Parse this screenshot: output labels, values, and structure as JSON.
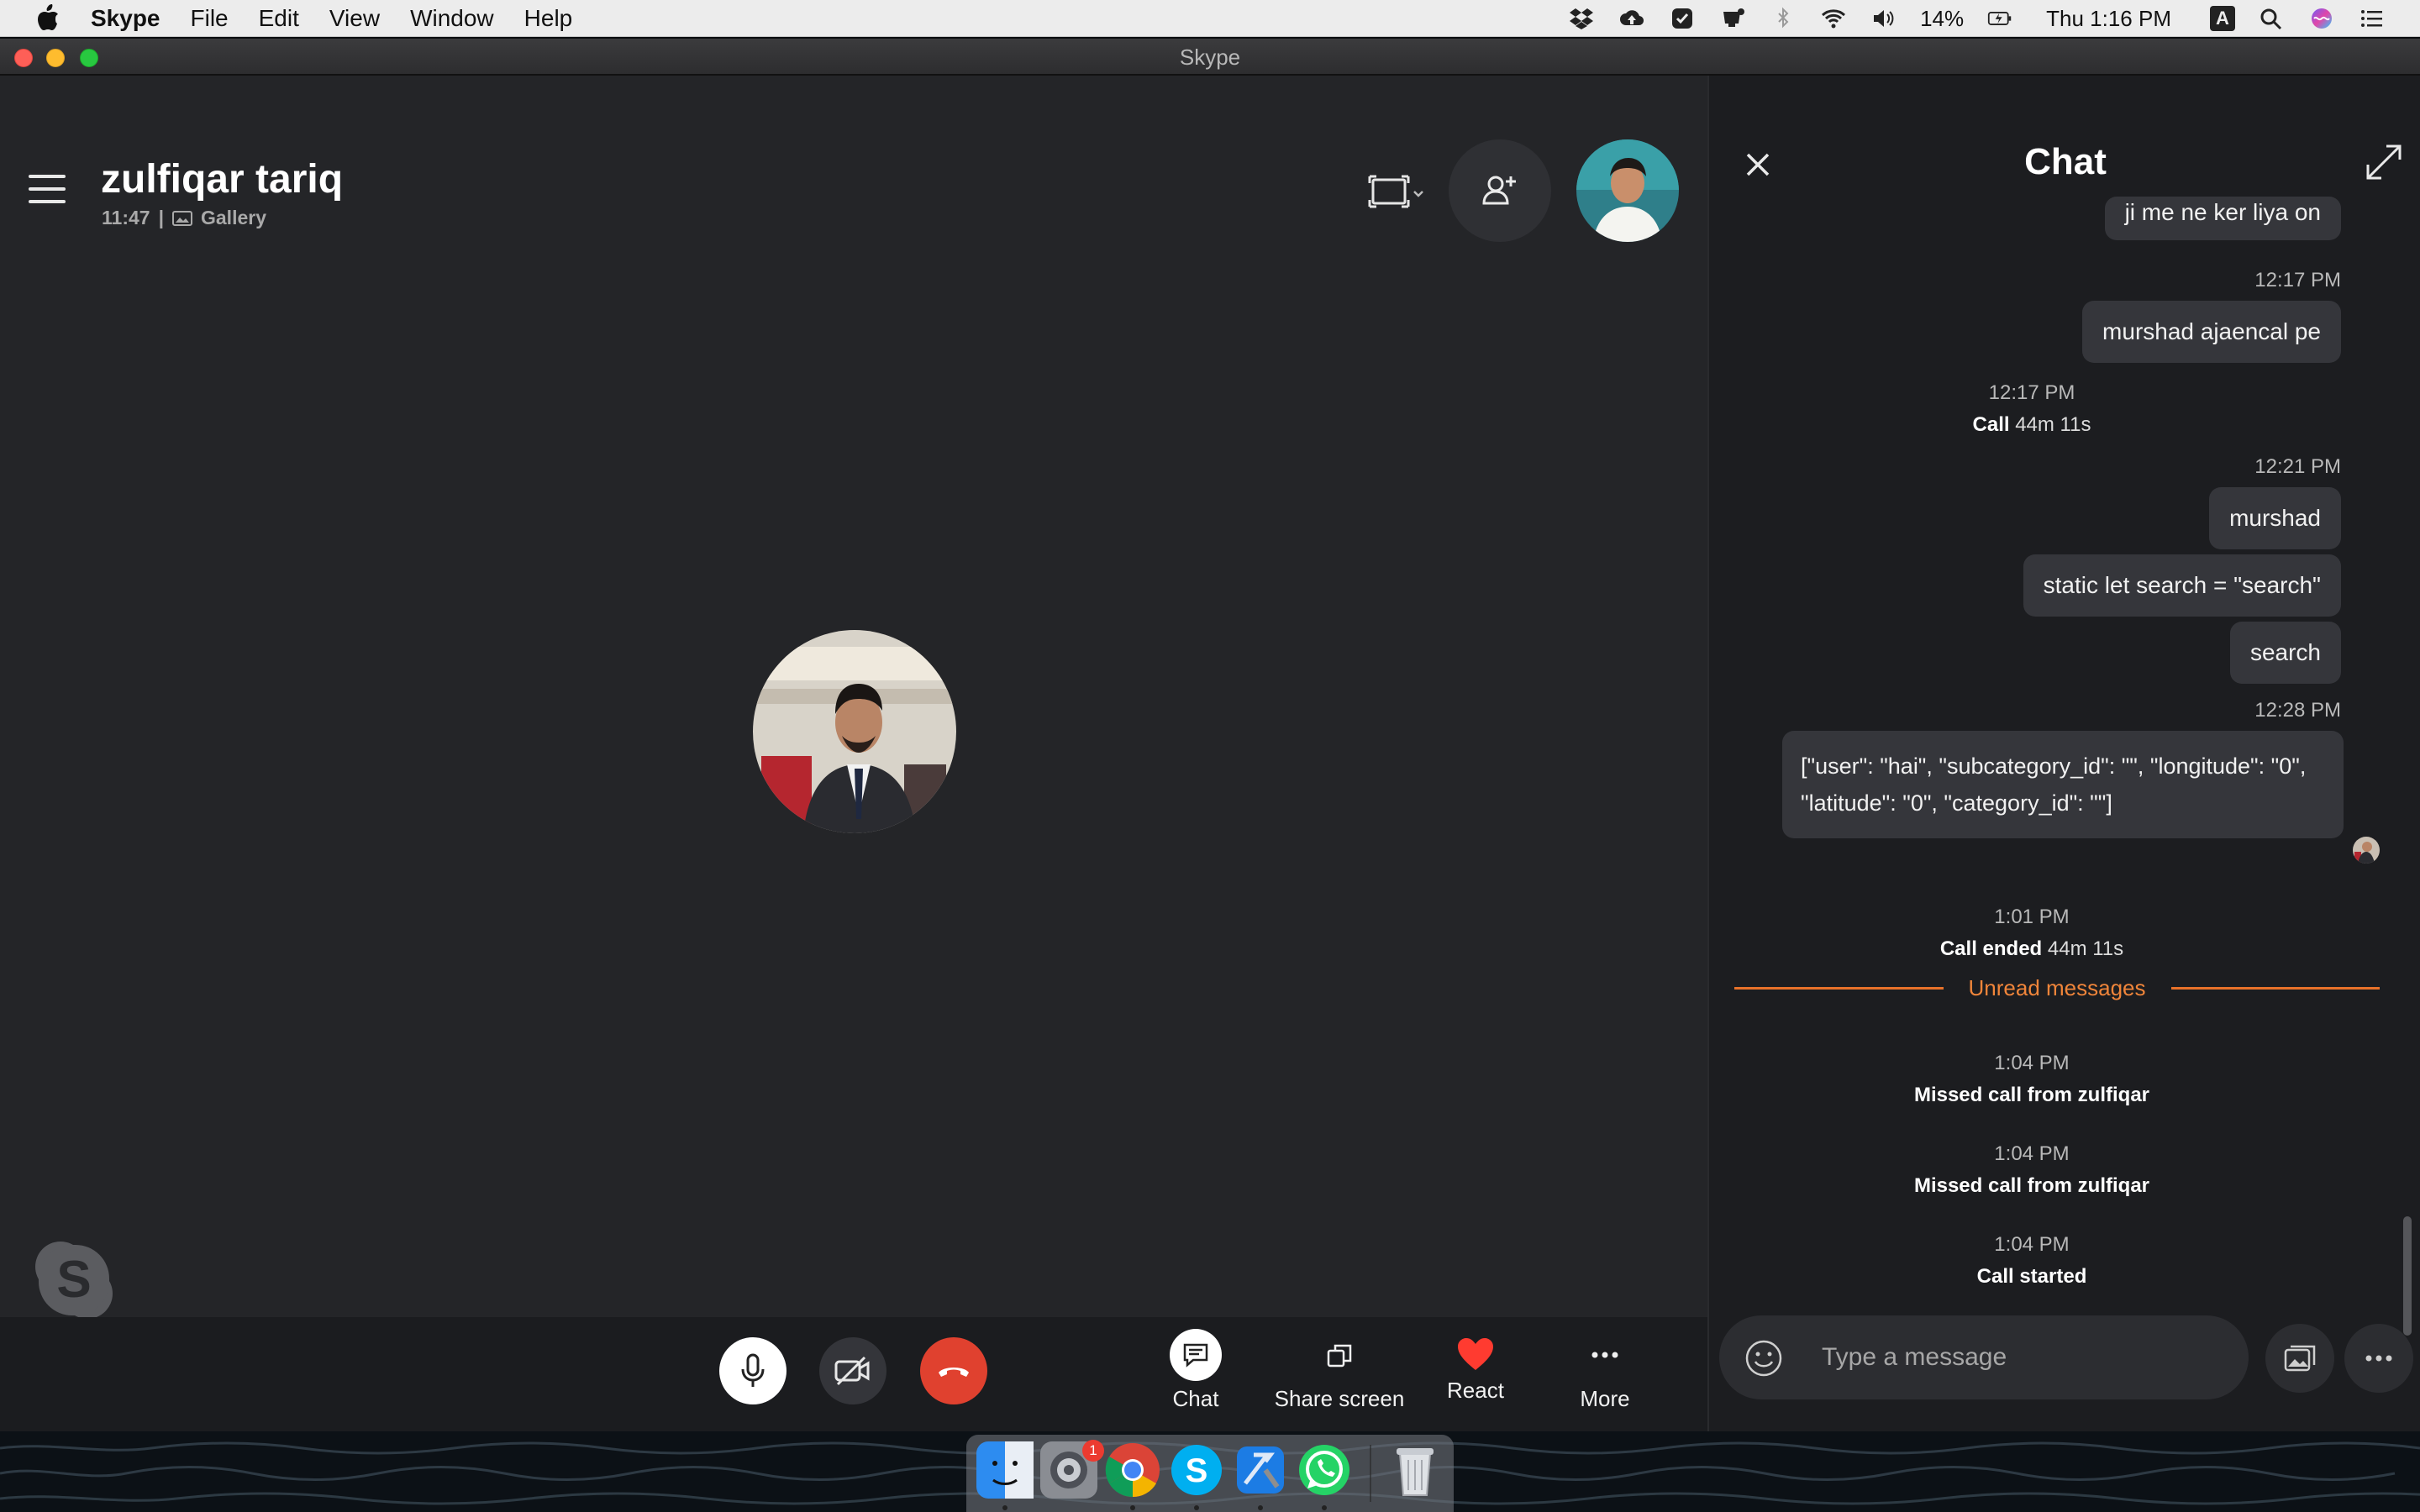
{
  "menubar": {
    "app_name": "Skype",
    "menus": [
      "File",
      "Edit",
      "View",
      "Window",
      "Help"
    ],
    "battery": "14%",
    "clock": "Thu 1:16 PM",
    "input_source": "A"
  },
  "window": {
    "title": "Skype"
  },
  "call": {
    "contact_name": "zulfiqar tariq",
    "duration": "11:47",
    "separator": "|",
    "view_mode": "Gallery"
  },
  "controls": {
    "chat": "Chat",
    "share_screen": "Share screen",
    "react": "React",
    "more": "More"
  },
  "chat": {
    "title": "Chat",
    "messages": {
      "partial": "ji me ne ker liya on",
      "t1": "12:17 PM",
      "m1": "murshad ajaencal pe",
      "t2": "12:17 PM",
      "call_label": "Call",
      "call_duration": "44m 11s",
      "t3": "12:21 PM",
      "m2": "murshad",
      "m3": "static let search = \"search\"",
      "m4": "search",
      "t4": "12:28 PM",
      "m5": "[\"user\": \"hai\", \"subcategory_id\": \"\", \"longitude\": \"0\", \"latitude\": \"0\", \"category_id\": \"\"]",
      "t5": "1:01 PM",
      "call_ended_label": "Call ended",
      "call_ended_duration": "44m 11s",
      "unread": "Unread messages",
      "t6": "1:04 PM",
      "missed1": "Missed call from zulfiqar",
      "t7": "1:04 PM",
      "missed2": "Missed call from zulfiqar",
      "t8": "1:04 PM",
      "call_started": "Call started"
    },
    "composer_placeholder": "Type a message"
  },
  "dock": {
    "apps": [
      "Finder",
      "System Preferences",
      "Google Chrome",
      "Skype",
      "Xcode",
      "WhatsApp",
      "Trash"
    ],
    "badge": "1"
  },
  "colors": {
    "end_call": "#e0412f",
    "unread_accent": "#e8722a",
    "react_heart": "#ff3b30"
  }
}
